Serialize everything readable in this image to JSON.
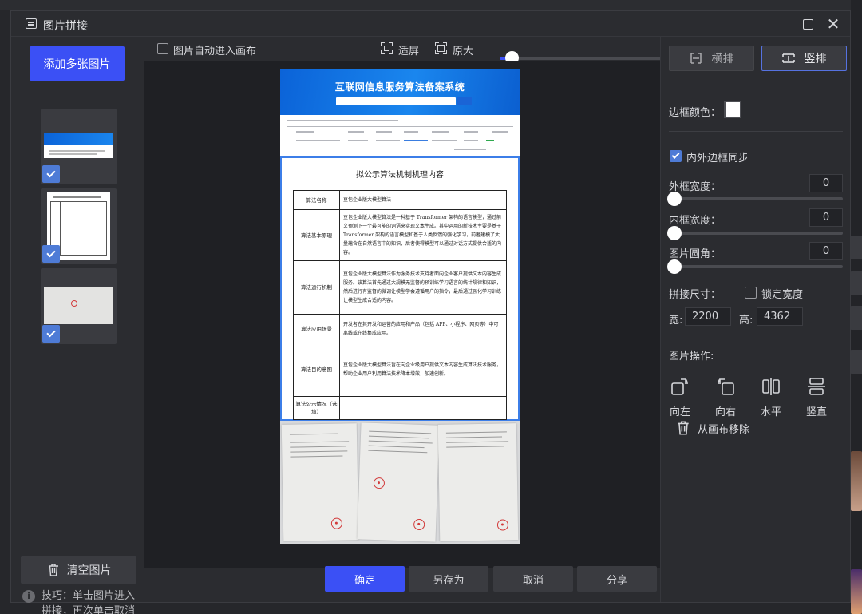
{
  "window": {
    "title": "图片拼接"
  },
  "left_panel": {
    "add_button": "添加多张图片",
    "clear_button": "清空图片",
    "tip": "技巧：单击图片进入拼接，再次单击取消"
  },
  "toolbar": {
    "auto_enter_label": "图片自动进入画布",
    "fit_label": "适屏",
    "original_label": "原大",
    "zoom_level": 0.07
  },
  "canvas_doc": {
    "header_site": "互联网信息服务算法备案系统",
    "page_title": "拟公示算法机制机理内容",
    "table": [
      {
        "name": "算法名称",
        "value": "豆包企业版大模型算法"
      },
      {
        "name": "算法基本原理",
        "value": "豆包企业版大模型算法是一种基于 Transformer 架构的语言模型，通过前文预测下一个最可能的词语来实现文本生成。其中运用的新技术主要是基于 Transformer 架构的语言模型和基于人类反馈的强化学习，前者建模了大量蕴含在自然语言中的知识，后者使得模型可以通过对话方式提供合适的内容。"
      },
      {
        "name": "算法运行机制",
        "value": "豆包企业版大模型算法作为服务技术支持者面向企业客户提供文本内容生成服务。该算法首先通过大规模无监督的预训练学习语言的统计规律和知识，然后进行有监督的微调让模型学会遵循用户的指令，最后通过强化学习训练让模型生成合适的内容。"
      },
      {
        "name": "算法应用场景",
        "value": "开发者在其开发和运营的应用和产品（包括 APP、小程序、网页等）中可离线或在线集成应用。"
      },
      {
        "name": "算法目的意图",
        "value": "豆包企业版大模型算法旨在向企业级用户提供文本内容生成算法技术服务，帮助企业用户利用算法技术降本增效，加速创新。"
      },
      {
        "name": "算法公示情况（选填）",
        "value": ""
      }
    ]
  },
  "footer": {
    "confirm": "确定",
    "save_as": "另存为",
    "cancel": "取消",
    "share": "分享"
  },
  "right_panel": {
    "horizontal_mode": "横排",
    "vertical_mode": "竖排",
    "active_mode": "竖排",
    "border_color_label": "边框颜色：",
    "border_color": "#ffffff",
    "sync_label": "内外边框同步",
    "sync_checked": true,
    "outer_width_label": "外框宽度：",
    "outer_width": "0",
    "inner_width_label": "内框宽度：",
    "inner_width": "0",
    "radius_label": "图片圆角：",
    "radius": "0",
    "size_label": "拼接尺寸：",
    "lock_width_label": "锁定宽度",
    "lock_width_checked": false,
    "width_label": "宽:",
    "width_value": "2200",
    "height_label": "高:",
    "height_value": "4362",
    "ops_label": "图片操作:",
    "ops": {
      "rotate_left": "向左",
      "rotate_right": "向右",
      "flip_horizontal": "水平",
      "flip_vertical": "竖直"
    },
    "remove_label": "从画布移除"
  },
  "colors": {
    "accent": "#3b50f5",
    "check": "#4e7bd6",
    "panel": "#2b2c30",
    "canvas": "#1f2024"
  }
}
